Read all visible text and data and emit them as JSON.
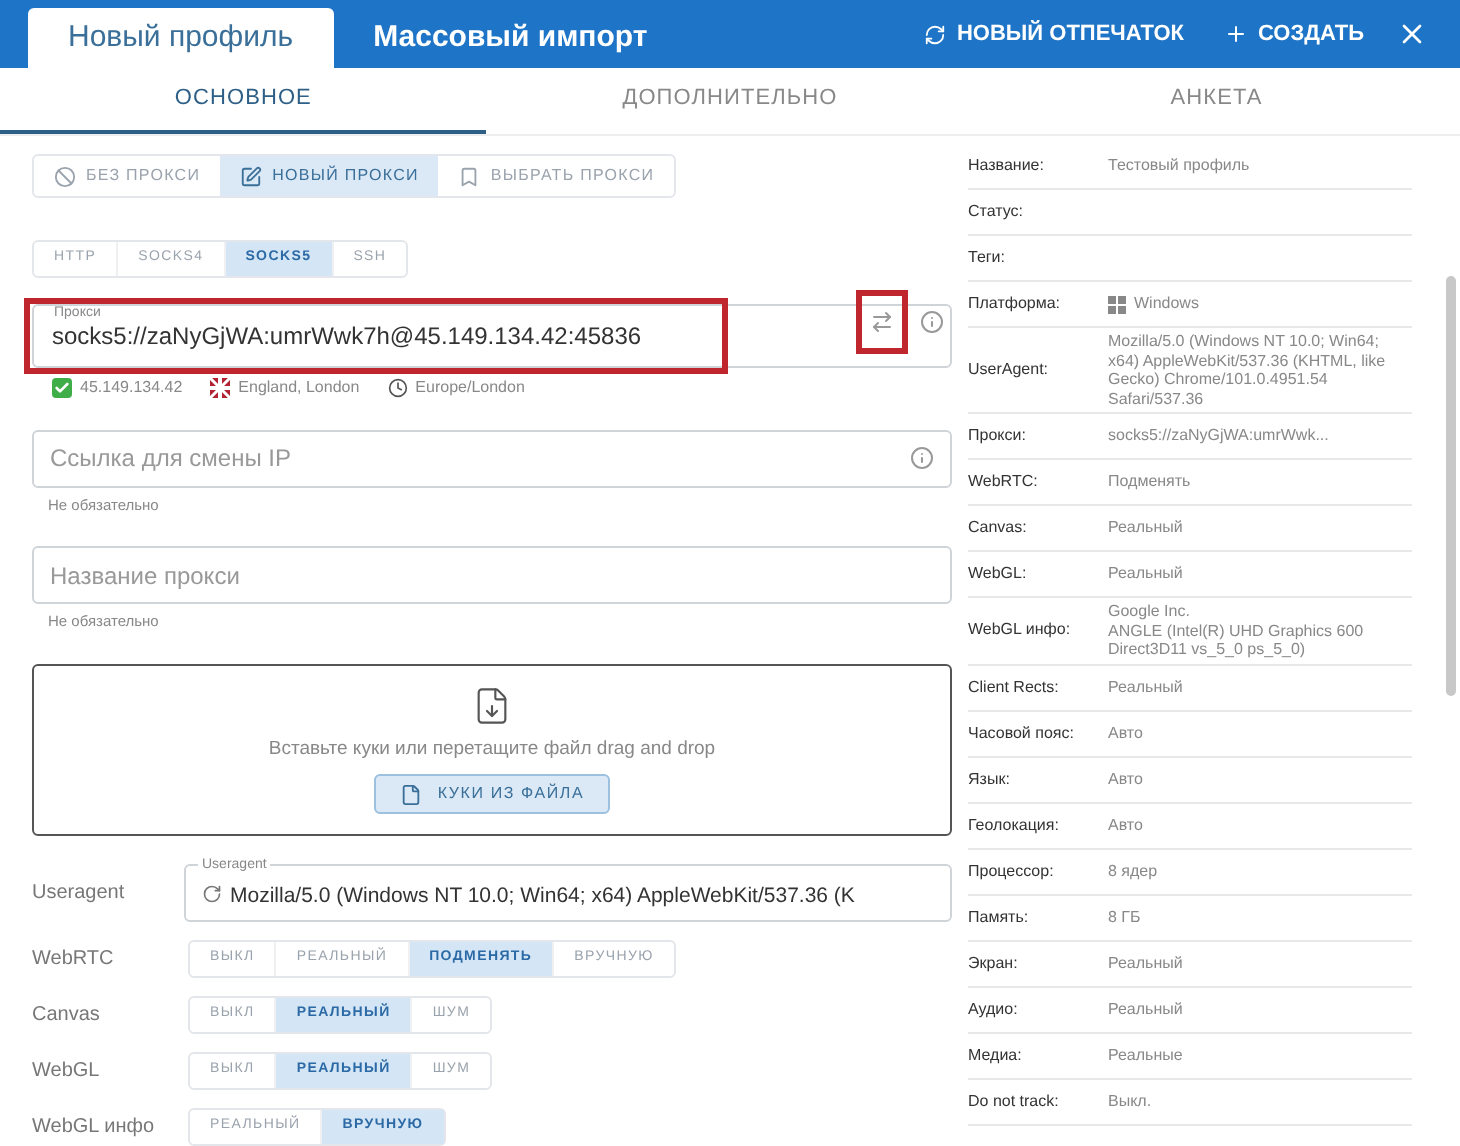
{
  "header": {
    "tabs": [
      {
        "label": "Новый профиль",
        "selected": true
      },
      {
        "label": "Массовый импорт",
        "selected": false
      }
    ],
    "actions": [
      {
        "label": "НОВЫЙ ОТПЕЧАТОК",
        "kind": "refresh"
      },
      {
        "label": "СОЗДАТЬ",
        "kind": "plus"
      }
    ]
  },
  "subtabs": [
    {
      "label": "ОСНОВНОЕ",
      "selected": true
    },
    {
      "label": "ДОПОЛНИТЕЛЬНО",
      "selected": false
    },
    {
      "label": "АНКЕТА",
      "selected": false
    }
  ],
  "proxy_modes": [
    {
      "label": "БЕЗ ПРОКСИ",
      "kind": "none",
      "selected": false
    },
    {
      "label": "НОВЫЙ ПРОКСИ",
      "kind": "edit",
      "selected": true
    },
    {
      "label": "ВЫБРАТЬ ПРОКСИ",
      "kind": "bookmark",
      "selected": false
    }
  ],
  "proxy_types": [
    {
      "label": "HTTP",
      "selected": false
    },
    {
      "label": "SOCKS4",
      "selected": false
    },
    {
      "label": "SOCKS5",
      "selected": true
    },
    {
      "label": "SSH",
      "selected": false
    }
  ],
  "proxy_field": {
    "label": "Прокси",
    "value": "socks5://zaNyGjWA:umrWwk7h@45.149.134.42:45836",
    "highlighted": true
  },
  "swap_button": {
    "highlighted": true
  },
  "proxy_info": [
    {
      "kind": "check",
      "text": "45.149.134.42"
    },
    {
      "kind": "flag",
      "text": "England, London"
    },
    {
      "kind": "clock",
      "text": "Europe/London"
    }
  ],
  "fields": [
    {
      "placeholder": "Ссылка для смены IP",
      "hint": "Не обязательно",
      "info": true
    },
    {
      "placeholder": "Название прокси",
      "hint": "Не обязательно",
      "info": false
    }
  ],
  "cookies": {
    "text": "Вставьте куки или перетащите файл drag and drop",
    "button": "КУКИ ИЗ ФАЙЛА"
  },
  "useragent": {
    "row_label": "Useragent",
    "field_label": "Useragent",
    "value": "Mozilla/5.0 (Windows NT 10.0; Win64; x64) AppleWebKit/537.36 (K"
  },
  "options": [
    {
      "label": "WebRTC",
      "choices": [
        {
          "label": "ВЫКЛ",
          "selected": false
        },
        {
          "label": "РЕАЛЬНЫЙ",
          "selected": false
        },
        {
          "label": "ПОДМЕНЯТЬ",
          "selected": true
        },
        {
          "label": "ВРУЧНУЮ",
          "selected": false
        }
      ]
    },
    {
      "label": "Canvas",
      "choices": [
        {
          "label": "ВЫКЛ",
          "selected": false
        },
        {
          "label": "РЕАЛЬНЫЙ",
          "selected": true
        },
        {
          "label": "ШУМ",
          "selected": false
        }
      ]
    },
    {
      "label": "WebGL",
      "choices": [
        {
          "label": "ВЫКЛ",
          "selected": false
        },
        {
          "label": "РЕАЛЬНЫЙ",
          "selected": true
        },
        {
          "label": "ШУМ",
          "selected": false
        }
      ]
    },
    {
      "label": "WebGL инфо",
      "choices": [
        {
          "label": "РЕАЛЬНЫЙ",
          "selected": false
        },
        {
          "label": "ВРУЧНУЮ",
          "selected": true
        }
      ]
    }
  ],
  "summary": [
    {
      "label": "Название:",
      "value": "Тестовый профиль"
    },
    {
      "label": "Статус:"
    },
    {
      "label": "Теги:"
    },
    {
      "label": "Платформа:",
      "value": "Windows",
      "kind": "platform"
    },
    {
      "label": "UserAgent:",
      "value": "Mozilla/5.0 (Windows NT 10.0; Win64; x64) AppleWebKit/537.36 (KHTML, like Gecko) Chrome/101.0.4951.54 Safari/537.36"
    },
    {
      "label": "Прокси:",
      "value": "socks5://zaNyGjWA:umrWwk..."
    },
    {
      "label": "WebRTC:",
      "value": "Подменять"
    },
    {
      "label": "Canvas:",
      "value": "Реальный"
    },
    {
      "label": "WebGL:",
      "value": "Реальный"
    },
    {
      "label": "WebGL инфо:",
      "value": "Google Inc.\nANGLE (Intel(R) UHD Graphics 600 Direct3D11 vs_5_0 ps_5_0)"
    },
    {
      "label": "Client Rects:",
      "value": "Реальный"
    },
    {
      "label": "Часовой пояс:",
      "value": "Авто"
    },
    {
      "label": "Язык:",
      "value": "Авто"
    },
    {
      "label": "Геолокация:",
      "value": "Авто"
    },
    {
      "label": "Процессор:",
      "value": "8 ядер"
    },
    {
      "label": "Память:",
      "value": "8 ГБ"
    },
    {
      "label": "Экран:",
      "value": "Реальный"
    },
    {
      "label": "Аудио:",
      "value": "Реальный"
    },
    {
      "label": "Медиа:",
      "value": "Реальные"
    },
    {
      "label": "Do not track:",
      "value": "Выкл."
    }
  ]
}
